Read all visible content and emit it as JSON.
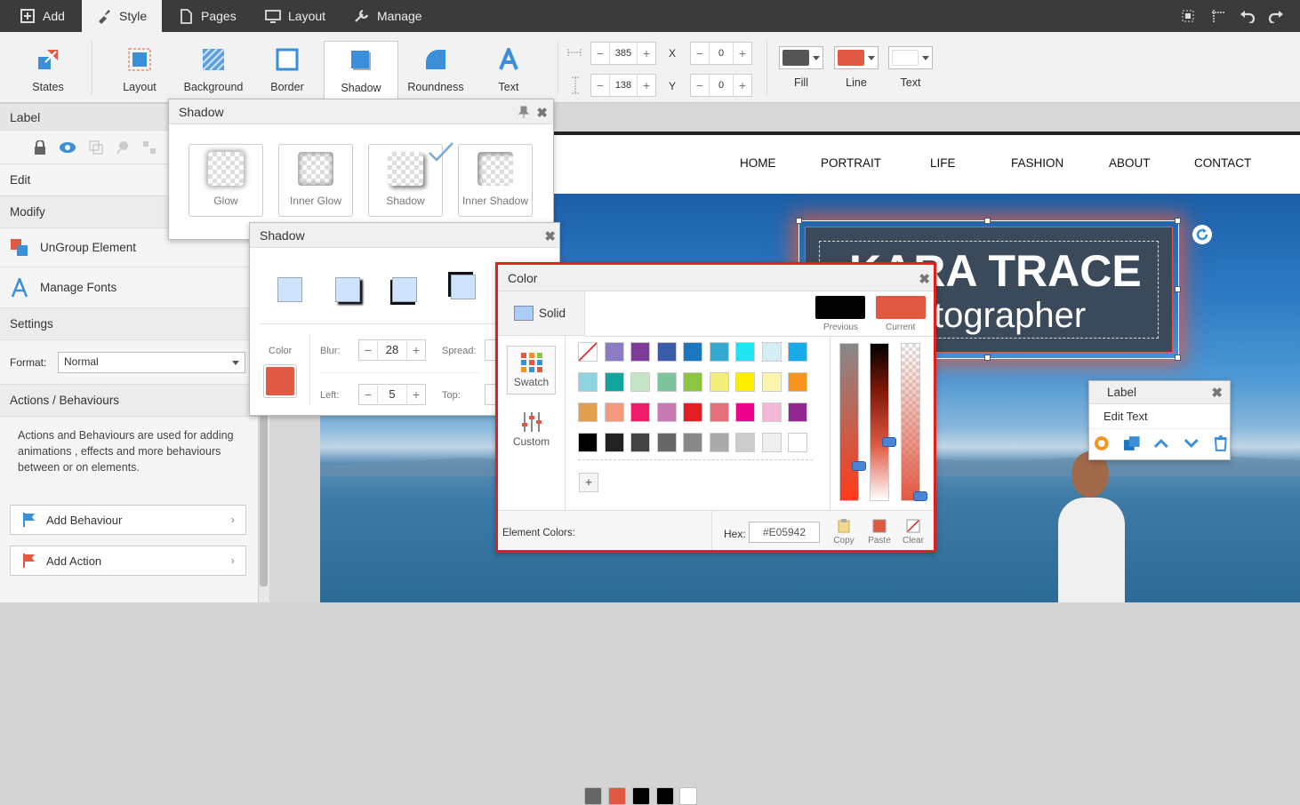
{
  "topbar": {
    "tabs": [
      {
        "label": "Add",
        "icon": "plus-icon"
      },
      {
        "label": "Style",
        "icon": "brush-icon",
        "active": true
      },
      {
        "label": "Pages",
        "icon": "page-icon"
      },
      {
        "label": "Layout",
        "icon": "monitor-icon"
      },
      {
        "label": "Manage",
        "icon": "wrench-icon"
      }
    ],
    "right_icons": [
      "select-icon",
      "ruler-icon",
      "undo-icon",
      "redo-icon"
    ]
  },
  "toolbar": {
    "buttons": [
      {
        "label": "States"
      },
      {
        "label": "Layout"
      },
      {
        "label": "Background"
      },
      {
        "label": "Border"
      },
      {
        "label": "Shadow",
        "active": true
      },
      {
        "label": "Roundness"
      },
      {
        "label": "Text"
      }
    ],
    "width_value": "385",
    "height_value": "138",
    "x_label": "X",
    "y_label": "Y",
    "x_value": "0",
    "y_value": "0",
    "swatches": [
      {
        "label": "Fill",
        "color": "#555555"
      },
      {
        "label": "Line",
        "color": "#E05942"
      },
      {
        "label": "Text",
        "color": "#FFFFFF"
      }
    ]
  },
  "left_panel": {
    "title": "Label",
    "rows": {
      "edit": "Edit",
      "modify": "Modify",
      "ungroup": "UnGroup Element",
      "manage_fonts": "Manage Fonts",
      "settings": "Settings",
      "format_label": "Format:",
      "format_value": "Normal",
      "actions": "Actions / Behaviours",
      "actions_desc": "Actions and Behaviours are used for adding animations , effects and more behaviours between or on elements.",
      "add_behaviour": "Add Behaviour",
      "add_action": "Add Action"
    }
  },
  "site": {
    "nav": [
      "HOME",
      "PORTRAIT",
      "LIFE",
      "FASHION",
      "ABOUT",
      "CONTACT"
    ],
    "headline": "KARA TRACE",
    "subheadline": "tographer"
  },
  "shadow_panel": {
    "title": "Shadow",
    "cards": [
      "Glow",
      "Inner Glow",
      "Shadow",
      "Inner Shadow"
    ]
  },
  "shadow_panel2": {
    "title": "Shadow",
    "color_label": "Color",
    "color": "#E05942",
    "blur_label": "Blur:",
    "blur_value": "28",
    "spread_label": "Spread:",
    "left_label": "Left:",
    "left_value": "5",
    "top_label": "Top:"
  },
  "color_panel": {
    "title": "Color",
    "mode": "Solid",
    "previous_label": "Previous",
    "current_label": "Current",
    "previous_color": "#000000",
    "current_color": "#E05942",
    "swatch_label": "Swatch",
    "custom_label": "Custom",
    "grid": [
      [
        "none",
        "#8e7cc3",
        "#7d3c98",
        "#3a5ba8",
        "#1a76c0",
        "#35a8d0",
        "#1ee5ef",
        "#d6eef5",
        "#18a9e8"
      ],
      [
        "#8fd3de",
        "#12a59b",
        "#c5e5c5",
        "#7cc59a",
        "#8cc63f",
        "#f3ee7a",
        "#ffee00",
        "#fbf5b0",
        "#f7941d"
      ],
      [
        "#e0a050",
        "#f5997c",
        "#ec1c6b",
        "#c97ab4",
        "#e31e24",
        "#e56f7b",
        "#ec008c",
        "#f3b6d8",
        "#92278f"
      ],
      [
        "#000000",
        "#222222",
        "#444444",
        "#666666",
        "#888888",
        "#aaaaaa",
        "#cccccc",
        "#eeeeee",
        "#ffffff"
      ]
    ],
    "element_colors_label": "Element Colors:",
    "element_colors": [
      "#666666",
      "#E05942",
      "#000000",
      "#000000",
      "#ffffff"
    ],
    "hex_label": "Hex:",
    "hex_value": "#E05942",
    "copy_label": "Copy",
    "paste_label": "Paste",
    "clear_label": "Clear"
  },
  "label_panel": {
    "title": "Label",
    "edit_text": "Edit Text"
  }
}
